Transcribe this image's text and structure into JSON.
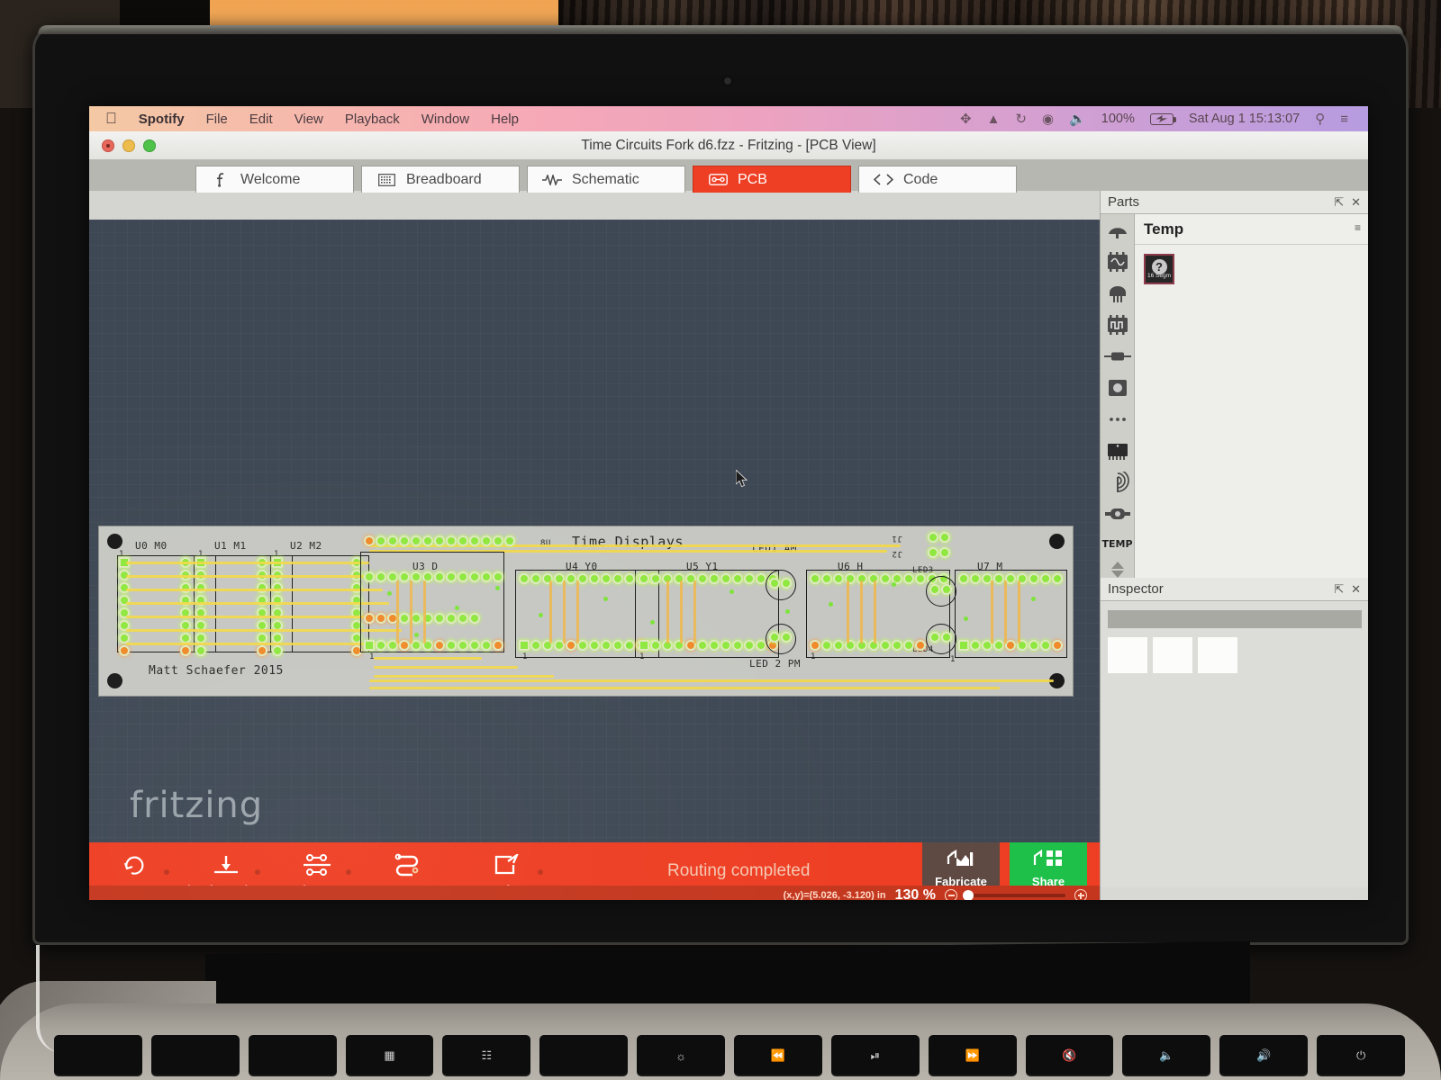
{
  "menubar": {
    "apple": "",
    "app": "Spotify",
    "items": [
      "File",
      "Edit",
      "View",
      "Playback",
      "Window",
      "Help"
    ],
    "right_icons": [
      "dropbox-icon",
      "drive-icon",
      "timemachine-icon",
      "wifi-icon",
      "volume-icon"
    ],
    "battery_percent": "100%",
    "datetime": "Sat Aug 1  15:13:07",
    "search_icon": "search-icon",
    "notifications_icon": "list-icon"
  },
  "window": {
    "title": "Time Circuits Fork d6.fzz - Fritzing - [PCB View]"
  },
  "tabs": [
    {
      "label": "Welcome",
      "icon": "fritzing-f-icon",
      "active": false
    },
    {
      "label": "Breadboard",
      "icon": "breadboard-icon",
      "active": false
    },
    {
      "label": "Schematic",
      "icon": "waveform-icon",
      "active": false
    },
    {
      "label": "PCB",
      "icon": "pcb-icon",
      "active": true
    },
    {
      "label": "Code",
      "icon": "code-icon",
      "active": false
    }
  ],
  "canvas": {
    "watermark": "fritzing",
    "background_color": "#3e4854"
  },
  "pcb": {
    "title": "Time Displays",
    "credit": "Matt Schaefer 2015",
    "labels": [
      "U0 M0",
      "U1 M1",
      "U2 M2",
      "U3 D",
      "U4 Y0",
      "U5 Y1",
      "U6 H",
      "U7 M",
      "LED1 AM",
      "LED 2 PM",
      "LED3",
      "LED4",
      "J1",
      "J2",
      "1",
      "8U"
    ],
    "chips": [
      {
        "name": "U0 M0",
        "pin1": "1"
      },
      {
        "name": "U1 M1",
        "pin1": "1"
      },
      {
        "name": "U2 M2",
        "pin1": "1"
      },
      {
        "name": "U3 D",
        "pin1": "1"
      },
      {
        "name": "U4 Y0",
        "pin1": "1"
      },
      {
        "name": "U5 Y1",
        "pin1": "1"
      },
      {
        "name": "U6 H",
        "pin1": "1"
      },
      {
        "name": "U7 M",
        "pin1": "1"
      }
    ],
    "leds": [
      "LED1 AM",
      "LED 2 PM",
      "LED3",
      "LED4"
    ],
    "colors": {
      "board": "#c6c7c2",
      "trace": "#f2d84a",
      "pad": "#8fe83f",
      "pad_alt": "#f08a2a"
    }
  },
  "toolbar": {
    "buttons": [
      {
        "label": "Rotate",
        "icon": "rotate-icon"
      },
      {
        "label": "View from Above",
        "icon": "view-from-above-icon"
      },
      {
        "label": "Both Layers",
        "icon": "both-layers-icon"
      },
      {
        "label": "Autoroute",
        "icon": "autoroute-icon"
      },
      {
        "label": "Export for PCB",
        "icon": "export-icon"
      }
    ],
    "status_message": "Routing completed",
    "fabricate_label": "Fabricate",
    "fabricate_icon": "factory-icon",
    "share_label": "Share",
    "share_icon": "share-grid-icon",
    "accent_color": "#ee3e23",
    "share_color": "#1ec04a",
    "fabricate_color": "#5e4a42"
  },
  "statusbar": {
    "coordinates": "(x,y)=(5.026, -3.120) in",
    "zoom": "130 %",
    "zoom_out_icon": "zoom-out-icon",
    "zoom_in_icon": "zoom-in-icon"
  },
  "parts_panel": {
    "title": "Parts",
    "bin_title": "Temp",
    "bin_rail_label": "TEMP",
    "part": {
      "caption": "16 Segm",
      "badge": "?"
    },
    "float_icon": "undock-icon",
    "close_icon": "close-icon",
    "menu_icon": "bin-menu-icon"
  },
  "inspector_panel": {
    "title": "Inspector",
    "float_icon": "undock-icon",
    "close_icon": "close-icon"
  },
  "keyboard": {
    "fn_keys": [
      "",
      "",
      "",
      "",
      "",
      "",
      "",
      "",
      "",
      "",
      "",
      "",
      ""
    ]
  }
}
